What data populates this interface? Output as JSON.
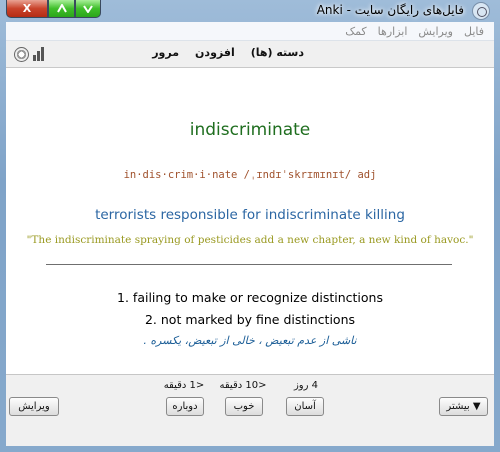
{
  "window": {
    "title": "فایل‌های رایگان سایت - Anki",
    "close_glyph": "X"
  },
  "menu": {
    "items": [
      "فایل",
      "ویرایش",
      "ابزارها",
      "کمک"
    ]
  },
  "toolbar": {
    "decks": "دسته (ها)",
    "add": "افزودن",
    "browse": "مرور"
  },
  "card": {
    "word": "indiscriminate",
    "pronunciation": "in·dis·crim·i·nate /ˌɪndɪˈskrɪmɪnɪt/ adj",
    "phrase": "terrorists responsible for indiscriminate killing",
    "quote": "\"The indiscriminate spraying of pesticides add a new chapter, a new kind of havoc.\"",
    "definition_1": "1. failing to make or recognize distinctions",
    "definition_2": "2. not marked by fine distinctions",
    "persian": "ناشی از عدم تبعیض ، خالی از تبعیض، یکسره ."
  },
  "answer_bar": {
    "intervals": {
      "again": "<1 دقیقه",
      "hard": "<10 دقیقه",
      "good": "4 روز"
    },
    "again_label": "دوباره",
    "good_label": "خوب",
    "easy_label": "آسان",
    "edit_label": "ویرایش",
    "more_label": "بیشتر ▼"
  },
  "colors": {
    "word": "#1f6e1f",
    "pronunciation": "#a0522d",
    "phrase": "#2b66a3",
    "quote": "#9a9a22",
    "persian": "#1c5e97"
  }
}
